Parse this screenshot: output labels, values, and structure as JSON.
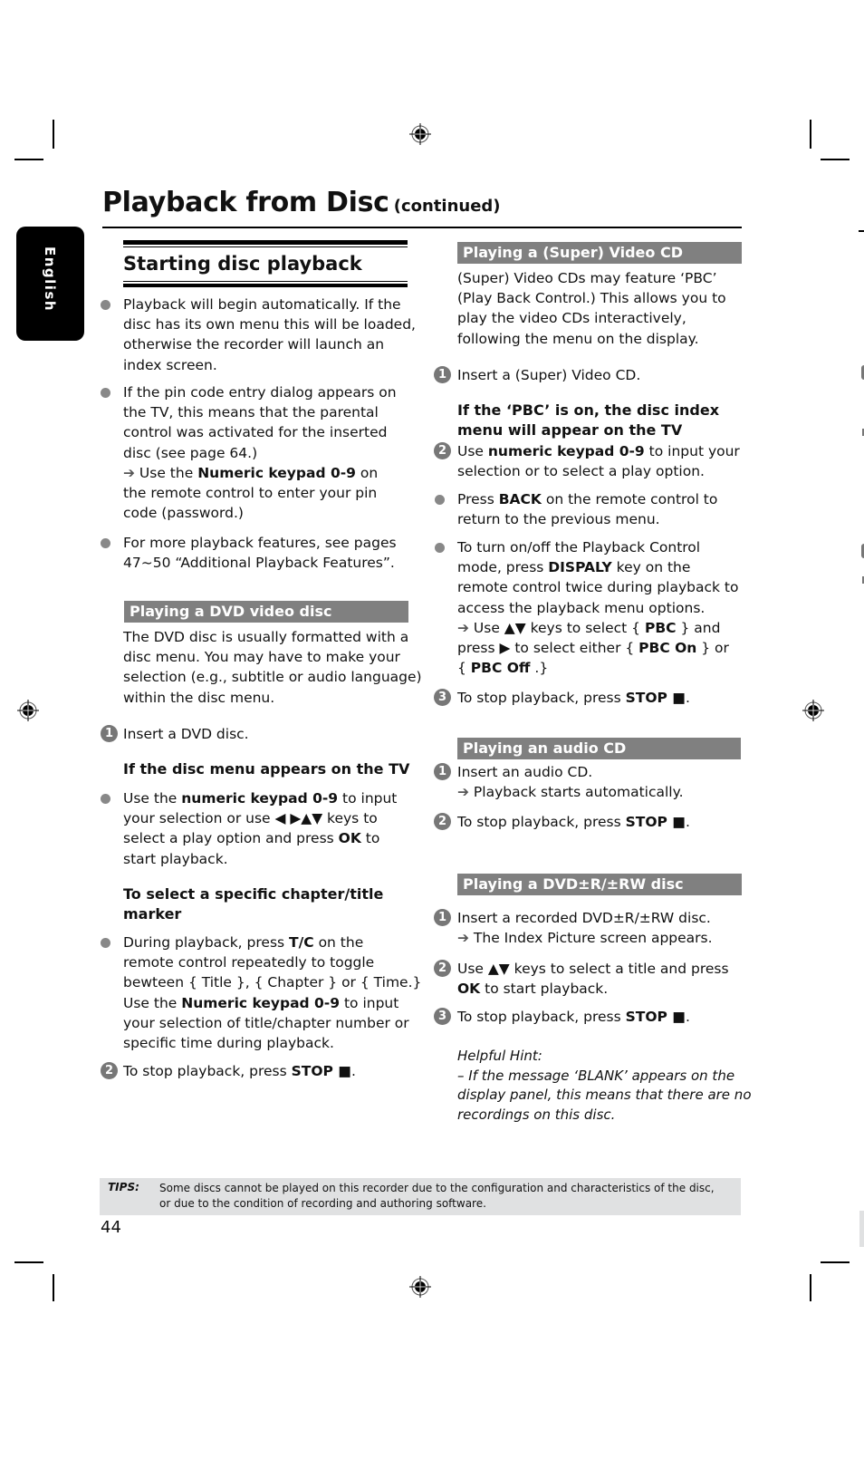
{
  "header": {
    "title": "Playback from Disc",
    "title_suffix": "(continued)"
  },
  "language_tab": "English",
  "left_column": {
    "section1": {
      "heading": "Starting disc playback",
      "bullets": [
        [
          "Playback will begin automatically. If the",
          "disc has its own menu this will be loaded,",
          "otherwise the recorder will launch an",
          "index screen."
        ],
        [
          "If the pin code entry dialog appears on",
          "the TV, this means that the parental",
          "control was activated for the inserted",
          "disc (see page 64.)"
        ],
        [
          "For more playback features, see pages",
          "47~50 “Additional Playback Features”."
        ]
      ],
      "pin_arrow": {
        "pre": " Use the ",
        "bold": "Numeric keypad 0-9",
        "post": " on",
        "line2": "the remote control to enter your pin",
        "line3": "code (password.)"
      }
    },
    "section2": {
      "heading": "Playing a DVD video disc",
      "intro": [
        "The DVD disc is usually formatted with a",
        "disc menu. You may have to make your",
        "selection (e.g., subtitle or audio language)",
        "within the disc menu."
      ],
      "step1": "Insert a DVD disc.",
      "subheading1": "If the disc menu appears on the TV",
      "bullet1": {
        "pre": "Use the ",
        "bold": "numeric keypad 0-9",
        "post": " to input",
        "line2": "your selection or use ◀ ▶▲▼ keys to",
        "line3_pre": "select a play option and press ",
        "line3_bold": "OK",
        "line3_post": " to",
        "line4": "start playback."
      },
      "subheading2": [
        "To select a specific chapter/title",
        "marker"
      ],
      "bullet2": {
        "l1_pre": "During playback, press ",
        "l1_bold": "T/C",
        "l1_post": " on the",
        "l2": "remote control repeatedly to toggle",
        "l3": "bewteen { Title }, { Chapter } or { Time.}",
        "l4_pre": "Use the ",
        "l4_bold": "Numeric keypad 0-9",
        "l4_post": " to input",
        "l5": "your selection of title/chapter number or",
        "l6": "specific time during playback."
      },
      "step2": {
        "pre": "To stop playback, press ",
        "bold": "STOP ■",
        "post": "."
      }
    }
  },
  "right_column": {
    "vcd": {
      "heading": "Playing a (Super) Video CD",
      "intro": [
        "(Super) Video CDs may feature ‘PBC’",
        "(Play Back Control.) This allows you to",
        "play the video CDs interactively,",
        "following the menu on the display."
      ],
      "step1": "Insert a (Super) Video CD.",
      "subheading": [
        "If the ‘PBC’ is on, the disc index",
        "menu will appear on the TV"
      ],
      "step2": {
        "pre": "Use ",
        "bold": "numeric keypad 0-9",
        "post": " to input your",
        "line2": "selection or to select a play option."
      },
      "bullet1": {
        "pre": "Press ",
        "bold": "BACK",
        "post": " on the remote control to",
        "line2": "return to the previous menu."
      },
      "bullet2": {
        "l1": "To turn on/off the Playback Control",
        "l2_pre": "mode, press ",
        "l2_bold": "DISPALY",
        "l2_post": " key on the",
        "l3": "remote control twice during playback to",
        "l4": "access the playback menu options.",
        "l5_pre": " Use ▲▼ keys to select { ",
        "l5_bold": "PBC",
        "l5_post": " } and",
        "l6_pre": "press ▶ to select either { ",
        "l6_bold": "PBC On",
        "l6_post": " } or",
        "l7_pre": "{ ",
        "l7_bold": "PBC Off",
        "l7_post": " .}"
      },
      "step3": {
        "pre": "To stop playback, press ",
        "bold": "STOP ■",
        "post": "."
      }
    },
    "audio": {
      "heading": "Playing an audio CD",
      "step1": "Insert an audio CD.",
      "step1_result": " Playback starts automatically.",
      "step2": {
        "pre": "To stop playback, press ",
        "bold": "STOP ■",
        "post": "."
      }
    },
    "dvdr": {
      "heading": "Playing a DVD±R/±RW disc",
      "step1": "Insert a recorded DVD±R/±RW disc.",
      "step1_result": " The Index Picture screen appears.",
      "step2": {
        "pre": "Use ▲▼ keys to select a title and press",
        "bold": "OK",
        "post": " to start playback."
      },
      "step3": {
        "pre": "To stop playback, press ",
        "bold": "STOP ■",
        "post": "."
      },
      "hint_title": "Helpful Hint:",
      "hint_lines": [
        "– If the message ‘BLANK’ appears on the",
        "display panel, this means that there are no",
        "recordings on this disc."
      ]
    }
  },
  "tips": {
    "label": "TIPS:",
    "lines": [
      "Some discs cannot be played on this recorder due to the configuration and characteristics of the disc,",
      "or due to the condition of recording and authoring software."
    ]
  },
  "page_number": "44",
  "step_numbers": [
    "1",
    "2",
    "3"
  ],
  "arrow_glyph": "➔",
  "colors": {
    "section_header_bg": "#808080",
    "tips_bg": "#e0e1e2",
    "bullet": "#888888"
  }
}
